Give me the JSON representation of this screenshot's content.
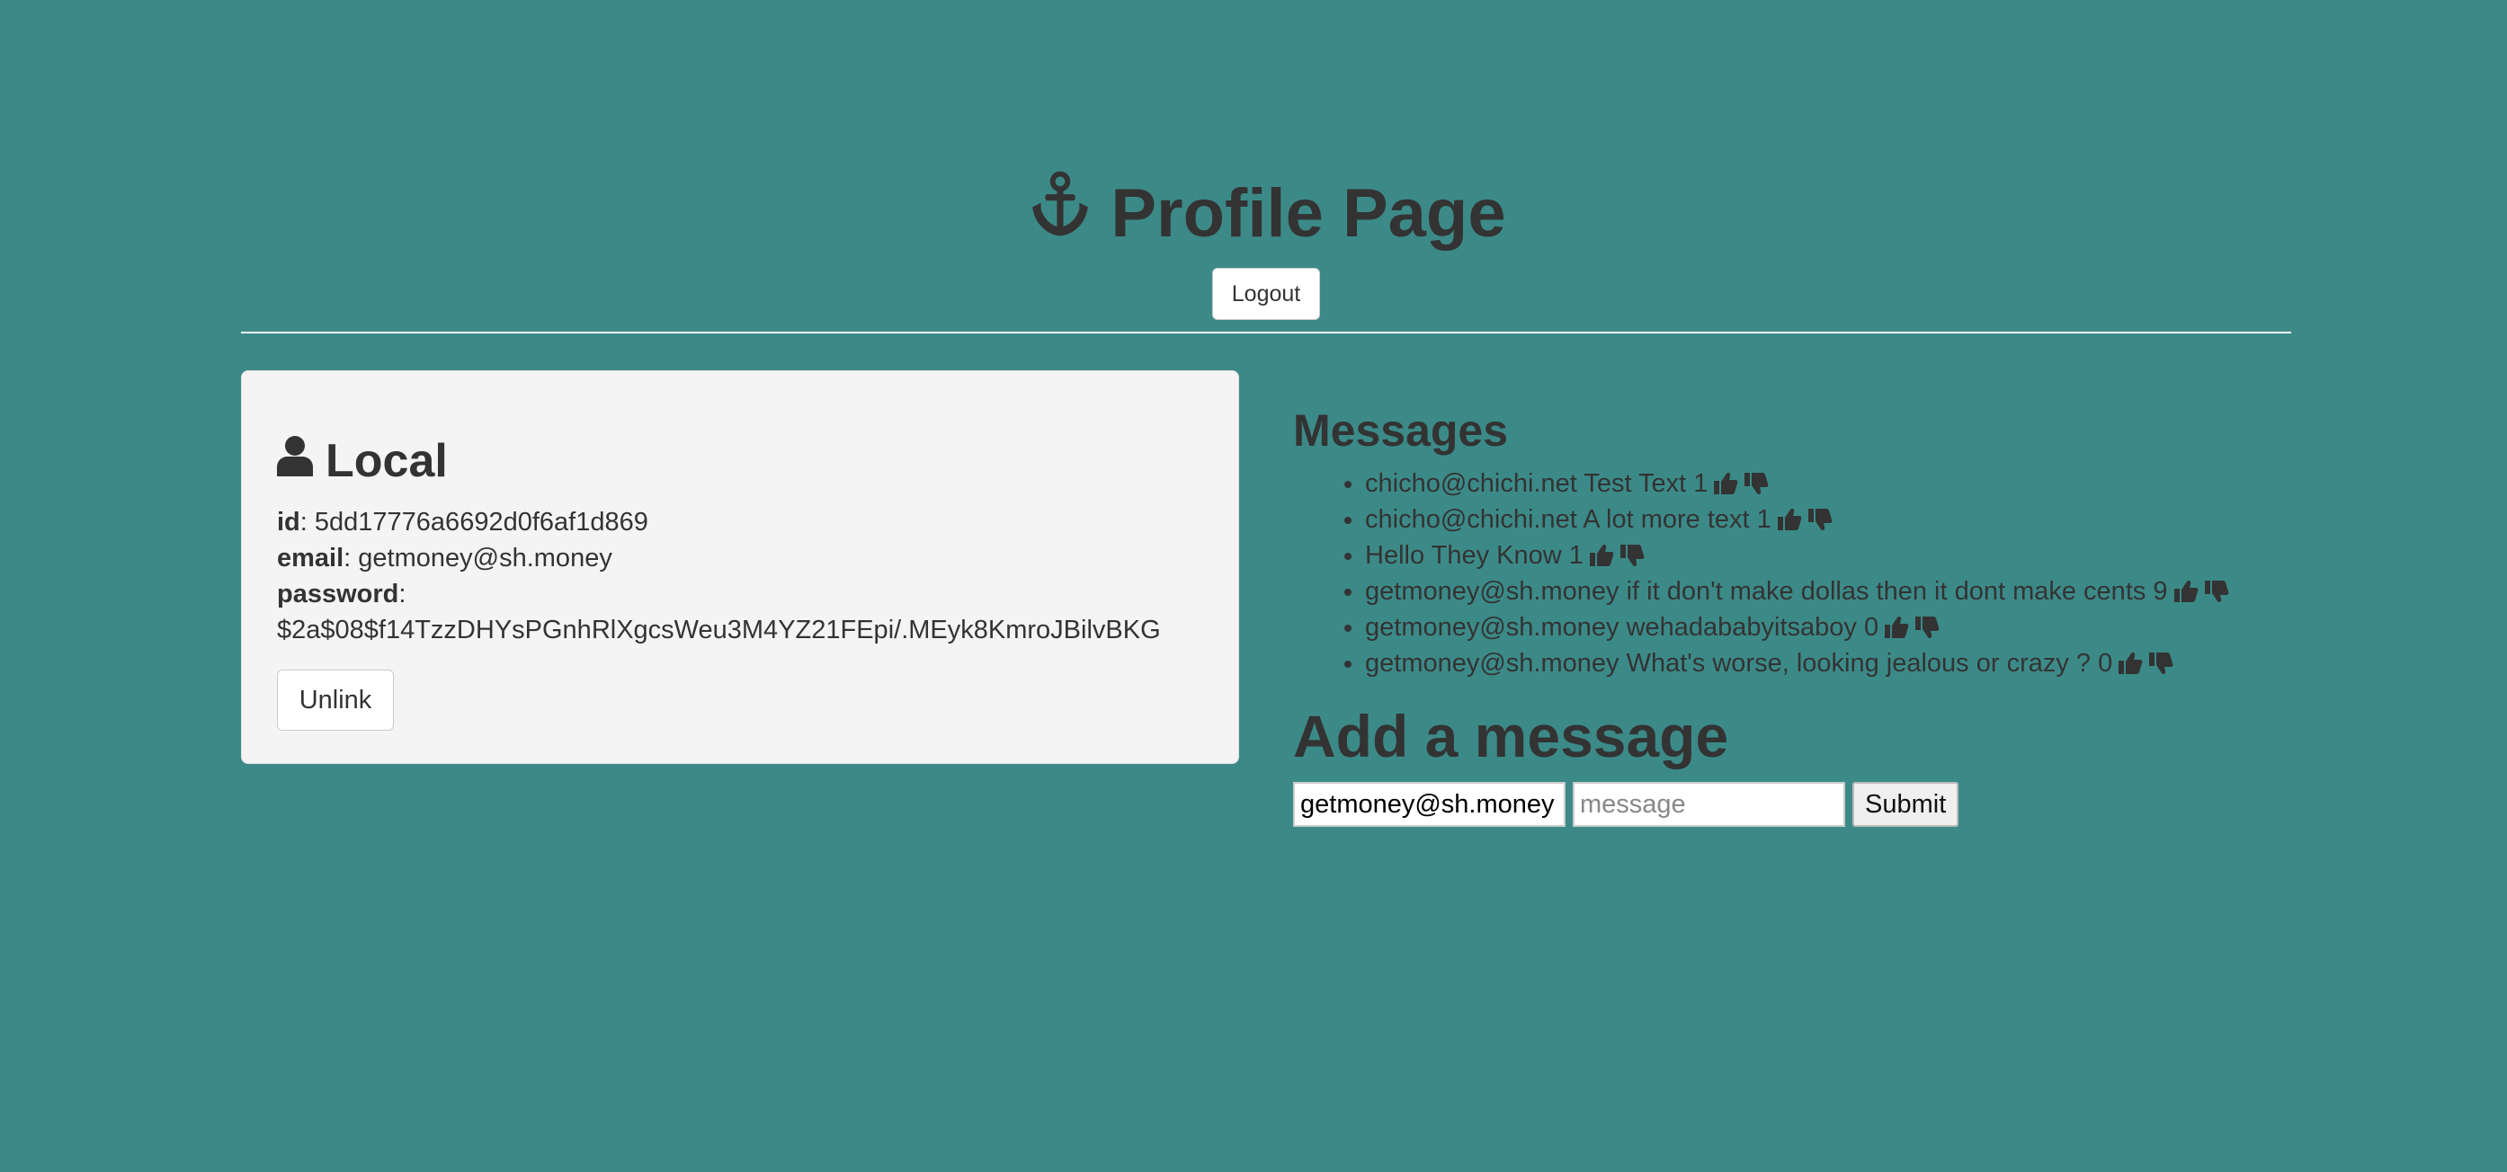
{
  "header": {
    "title": "Profile Page",
    "title_icon": "anchor-icon",
    "logout_label": "Logout"
  },
  "local": {
    "heading": "Local",
    "heading_icon": "user-icon",
    "id_label": "id",
    "id_value": "5dd17776a6692d0f6af1d869",
    "email_label": "email",
    "email_value": "getmoney@sh.money",
    "password_label": "password",
    "password_value": "$2a$08$f14TzzDHYsPGnhRlXgcsWeu3M4YZ21FEpi/.MEyk8KmroJBilvBKG",
    "unlink_label": "Unlink"
  },
  "messages": {
    "heading": "Messages",
    "items": [
      {
        "text": "chicho@chichi.net Test Text 1"
      },
      {
        "text": "chicho@chichi.net A lot more text 1"
      },
      {
        "text": "Hello They Know 1"
      },
      {
        "text": "getmoney@sh.money if it don't make dollas then it dont make cents 9"
      },
      {
        "text": "getmoney@sh.money wehadababyitsaboy 0"
      },
      {
        "text": "getmoney@sh.money What's worse, looking jealous or crazy ? 0"
      }
    ],
    "thumbs_up_icon": "thumbs-up-icon",
    "thumbs_down_icon": "thumbs-down-icon"
  },
  "add_message": {
    "heading": "Add a message",
    "name_value": "getmoney@sh.money",
    "message_placeholder": "message",
    "submit_label": "Submit"
  },
  "colors": {
    "background": "#3c8a88",
    "panel": "#f4f4f4",
    "text": "#333333"
  }
}
